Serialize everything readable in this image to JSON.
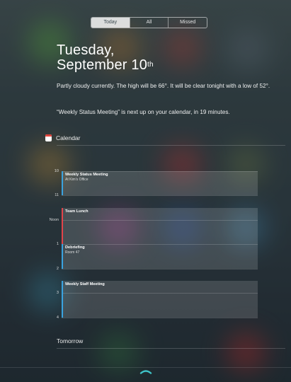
{
  "tabs": [
    {
      "label": "Today",
      "active": true
    },
    {
      "label": "All",
      "active": false
    },
    {
      "label": "Missed",
      "active": false
    }
  ],
  "date": {
    "line1": "Tuesday,",
    "line2": "September 10",
    "suffix": "th"
  },
  "summary": {
    "weather": "Partly cloudy currently. The high will be 66°. It will be clear tonight with a low of 52°.",
    "next_event": "“Weekly Status Meeting” is next up on your calendar, in 19 minutes."
  },
  "calendar": {
    "title": "Calendar",
    "icon": "calendar-icon",
    "hours": [
      "10",
      "11",
      "Noon",
      "1",
      "2",
      "3",
      "4"
    ],
    "events": [
      {
        "title": "Weekly Status Meeting",
        "location": "At Kim's Office",
        "color": "#3aa3e0"
      },
      {
        "title": "Team Lunch",
        "location": "",
        "color": "#e2444a"
      },
      {
        "title": "Debriefing",
        "location": "Room 47",
        "color": "#3aa3e0"
      },
      {
        "title": "Weekly Staff Meeting",
        "location": "",
        "color": "#3aa3e0"
      }
    ]
  },
  "tomorrow": {
    "label": "Tomorrow"
  },
  "handle": {
    "icon": "chevron-up-icon"
  }
}
